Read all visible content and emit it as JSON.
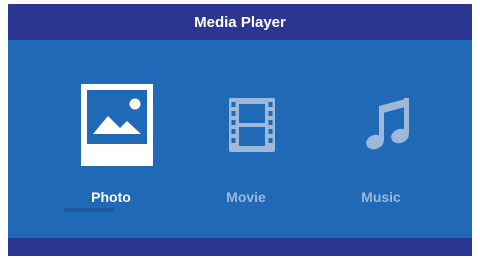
{
  "window": {
    "title": "Media Player"
  },
  "menu": {
    "items": [
      {
        "label": "Photo",
        "icon": "photo-icon",
        "selected": true
      },
      {
        "label": "Movie",
        "icon": "film-icon",
        "selected": false
      },
      {
        "label": "Music",
        "icon": "music-note-icon",
        "selected": false
      }
    ]
  },
  "colors": {
    "background": "#1f69b6",
    "titlebar": "#2b3592",
    "selected_label": "#ffffff",
    "unselected_label": "#9db8d8",
    "icon_inactive": "#9db8d8"
  }
}
